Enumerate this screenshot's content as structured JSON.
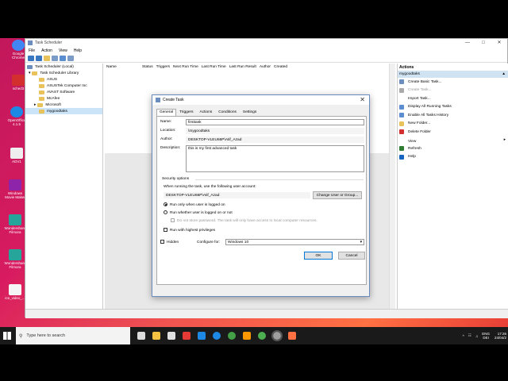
{
  "desktop": {
    "icons": [
      {
        "label": "Google Chrome",
        "color": "#4285f4"
      },
      {
        "label": "sched3",
        "color": "#d32f2f"
      },
      {
        "label": "OpenOffice 4.1.5",
        "color": "#1e88e5"
      },
      {
        "label": "ADV1",
        "color": "#eeeeee"
      },
      {
        "label": "Windows Movie Maker",
        "color": "#8e24aa"
      },
      {
        "label": "Wondershare Filmora",
        "color": "#26a69a"
      },
      {
        "label": "Wondershare Filmora",
        "color": "#26a69a"
      },
      {
        "label": "ice_video_...",
        "color": "#f5f5f5"
      }
    ]
  },
  "window": {
    "title": "Task Scheduler",
    "menu": [
      "File",
      "Action",
      "View",
      "Help"
    ],
    "tree": {
      "root": "Task Scheduler (Local)",
      "library": "Task Scheduler Library",
      "folders": [
        "ASUS",
        "ASUSTek Computer Inc",
        "AVAST Software",
        "McAfee",
        "Microsoft",
        "mygoodtaks"
      ]
    },
    "columns": [
      "Name",
      "Status",
      "Triggers",
      "Next Run Time",
      "Last Run Time",
      "Last Run Result",
      "Author",
      "Created"
    ],
    "actions": {
      "header": "Actions",
      "subheader": "mygoodtaks",
      "items": [
        {
          "label": "Create Basic Task...",
          "icon": "create-basic-task-icon",
          "color": "#6c8ebf",
          "disabled": false
        },
        {
          "label": "Create Task...",
          "icon": "create-task-icon",
          "color": "#aaaaaa",
          "disabled": true
        },
        {
          "label": "Import Task...",
          "icon": "import-icon",
          "color": "#ffffff",
          "disabled": false
        },
        {
          "label": "Display All Running Tasks",
          "icon": "running-tasks-icon",
          "color": "#5a8ed0",
          "disabled": false
        },
        {
          "label": "Enable All Tasks History",
          "icon": "history-icon",
          "color": "#5a8ed0",
          "disabled": false
        },
        {
          "label": "New Folder...",
          "icon": "folder-icon",
          "color": "#e8c25a",
          "disabled": false
        },
        {
          "label": "Delete Folder",
          "icon": "delete-icon",
          "color": "#d32f2f",
          "disabled": false
        },
        {
          "label": "View",
          "icon": "view-icon",
          "color": "#ffffff",
          "disabled": false
        },
        {
          "label": "Refresh",
          "icon": "refresh-icon",
          "color": "#2e7d32",
          "disabled": false
        },
        {
          "label": "Help",
          "icon": "help-icon",
          "color": "#1565c0",
          "disabled": false
        }
      ]
    }
  },
  "dialog": {
    "title": "Create Task",
    "tabs": [
      "General",
      "Triggers",
      "Actions",
      "Conditions",
      "Settings"
    ],
    "name_label": "Name:",
    "name_value": "firsttask",
    "location_label": "Location:",
    "location_value": "\\mygoodtaks",
    "author_label": "Author:",
    "author_value": "DESKTOP-VLEU66P\\Atif_Azad",
    "description_label": "Description:",
    "description_value": "this is my first advanced task",
    "security_label": "Security options",
    "run_as_label": "When running the task, use the following user account:",
    "user_account": "DESKTOP-VLEU66P\\Atif_Azad",
    "change_user_button": "Change User or Group...",
    "radio_logged_on": "Run only when user is logged on",
    "radio_whether": "Run whether user is logged on or not",
    "no_store_password": "Do not store password.  The task will only have access to local computer resources.",
    "highest_privileges": "Run with highest privileges",
    "hidden_label": "Hidden",
    "configure_label": "Configure for:",
    "configure_value": "Windows 10",
    "ok_button": "OK",
    "cancel_button": "Cancel"
  },
  "taskbar": {
    "search_placeholder": "Type here to search",
    "apps": [
      {
        "name": "task-view-icon",
        "color": "#dddddd"
      },
      {
        "name": "file-explorer-icon",
        "color": "#f5c242"
      },
      {
        "name": "store-icon",
        "color": "#e0e0e0"
      },
      {
        "name": "gift-icon",
        "color": "#e53935"
      },
      {
        "name": "mail-icon",
        "color": "#1e88e5"
      },
      {
        "name": "edge-icon",
        "color": "#1e88e5"
      },
      {
        "name": "chrome-icon",
        "color": "#43a047"
      },
      {
        "name": "vlc-icon",
        "color": "#ff9800"
      },
      {
        "name": "app-icon",
        "color": "#4caf50"
      },
      {
        "name": "task-scheduler-icon",
        "color": "#9e9e9e"
      },
      {
        "name": "recorder-icon",
        "color": "#ff7043"
      }
    ],
    "lang": "ENG",
    "locale": "DEI",
    "time": "17:26",
    "date": "24/04/2"
  }
}
